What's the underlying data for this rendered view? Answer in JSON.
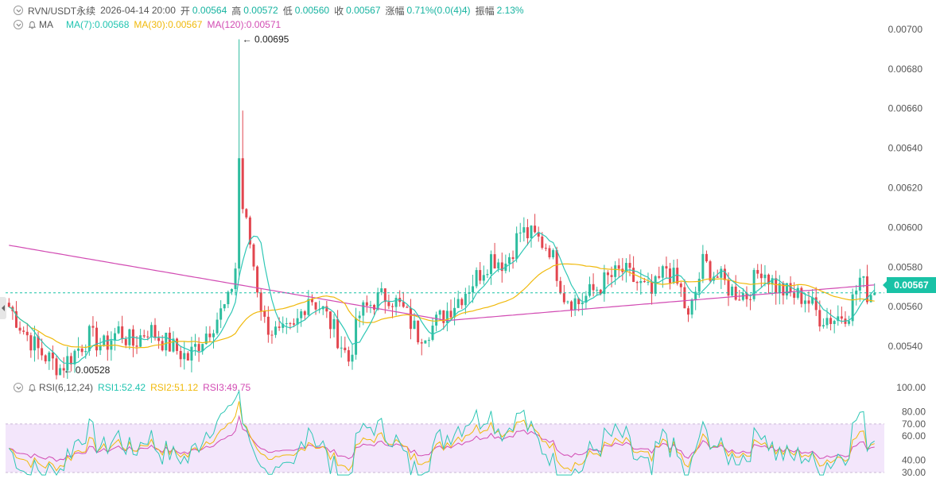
{
  "header": {
    "symbol": "RVN/USDT永续",
    "time": "2026-04-14 20:00",
    "open_label": "开",
    "open": "0.00564",
    "high_label": "高",
    "high": "0.00572",
    "low_label": "低",
    "low": "0.00560",
    "close_label": "收",
    "close": "0.00567",
    "change_label": "涨幅",
    "change": "0.71%(0.0(4)4)",
    "amplitude_label": "振幅",
    "amplitude": "2.13%"
  },
  "ma_legend": {
    "name": "MA",
    "ma7": "MA(7):0.00568",
    "ma30": "MA(30):0.00567",
    "ma120": "MA(120):0.00571"
  },
  "rsi_legend": {
    "name": "RSI(6,12,24)",
    "rsi1": "RSI1:52.42",
    "rsi2": "RSI2:51.12",
    "rsi3": "RSI3:49.75"
  },
  "colors": {
    "up": "#2ebd9f",
    "down": "#e2464f",
    "ma7": "#2ec7b5",
    "ma30": "#f0b90b",
    "ma120": "#d24bb3",
    "rsi_band": "#f3e6fb",
    "last_price": "#19c2a6"
  },
  "price_tag": "0.00567",
  "annotations": {
    "high": "← 0.00695",
    "low": "← 0.00528"
  },
  "chart_data": [
    {
      "type": "candlestick",
      "title": "RVN/USDT永续",
      "y_axis_ticks": [
        "0.00700",
        "0.00680",
        "0.00660",
        "0.00640",
        "0.00620",
        "0.00600",
        "0.00580",
        "0.00560",
        "0.00540"
      ],
      "ylim": [
        0.00524,
        0.00706
      ],
      "last_price": 0.00567,
      "marked_high": 0.00695,
      "marked_low": 0.00528,
      "series": [
        {
          "name": "MA(7)",
          "legend_value": 0.00568
        },
        {
          "name": "MA(30)",
          "legend_value": 0.00567
        },
        {
          "name": "MA(120)",
          "legend_value": 0.00571
        }
      ],
      "close_path": [
        [
          0,
          0.0056
        ],
        [
          4,
          0.00548
        ],
        [
          8,
          0.00538
        ],
        [
          12,
          0.00532
        ],
        [
          14,
          0.00529
        ],
        [
          18,
          0.00537
        ],
        [
          22,
          0.00545
        ],
        [
          26,
          0.0054
        ],
        [
          30,
          0.00548
        ],
        [
          34,
          0.00541
        ],
        [
          38,
          0.00549
        ],
        [
          42,
          0.00543
        ],
        [
          46,
          0.00538
        ],
        [
          49,
          0.00534
        ],
        [
          52,
          0.00542
        ],
        [
          56,
          0.00552
        ],
        [
          60,
          0.00562
        ],
        [
          62,
          0.0058
        ],
        [
          63,
          0.00635
        ],
        [
          64,
          0.0061
        ],
        [
          66,
          0.00592
        ],
        [
          68,
          0.0057
        ],
        [
          70,
          0.00552
        ],
        [
          74,
          0.00545
        ],
        [
          78,
          0.00548
        ],
        [
          82,
          0.00566
        ],
        [
          86,
          0.00558
        ],
        [
          90,
          0.00545
        ],
        [
          93,
          0.00533
        ],
        [
          96,
          0.00556
        ],
        [
          100,
          0.00563
        ],
        [
          104,
          0.00566
        ],
        [
          108,
          0.00558
        ],
        [
          112,
          0.00546
        ],
        [
          116,
          0.0055
        ],
        [
          120,
          0.00558
        ],
        [
          124,
          0.00566
        ],
        [
          128,
          0.00575
        ],
        [
          132,
          0.00585
        ],
        [
          136,
          0.00582
        ],
        [
          140,
          0.00598
        ],
        [
          144,
          0.00595
        ],
        [
          148,
          0.0059
        ],
        [
          152,
          0.00566
        ],
        [
          156,
          0.00562
        ],
        [
          160,
          0.00568
        ],
        [
          164,
          0.00574
        ],
        [
          168,
          0.00578
        ],
        [
          172,
          0.00572
        ],
        [
          176,
          0.00566
        ],
        [
          180,
          0.0058
        ],
        [
          184,
          0.00568
        ],
        [
          186,
          0.00553
        ],
        [
          190,
          0.00582
        ],
        [
          194,
          0.00575
        ],
        [
          198,
          0.00568
        ],
        [
          202,
          0.00566
        ],
        [
          206,
          0.0058
        ],
        [
          210,
          0.0057
        ],
        [
          214,
          0.00566
        ],
        [
          218,
          0.00565
        ],
        [
          222,
          0.00555
        ],
        [
          226,
          0.00554
        ],
        [
          230,
          0.00558
        ],
        [
          233,
          0.00574
        ],
        [
          235,
          0.00567
        ],
        [
          237,
          0.00567
        ]
      ]
    },
    {
      "type": "line",
      "title": "RSI(6,12,24)",
      "y_axis_ticks": [
        "100.00",
        "80.00",
        "70.00",
        "60.00",
        "40.00",
        "30.00"
      ],
      "ylim": [
        30,
        100
      ],
      "bands": [
        30,
        70
      ],
      "series": [
        {
          "name": "RSI1",
          "legend_value": 52.42
        },
        {
          "name": "RSI2",
          "legend_value": 51.12
        },
        {
          "name": "RSI3",
          "legend_value": 49.75
        }
      ]
    }
  ]
}
